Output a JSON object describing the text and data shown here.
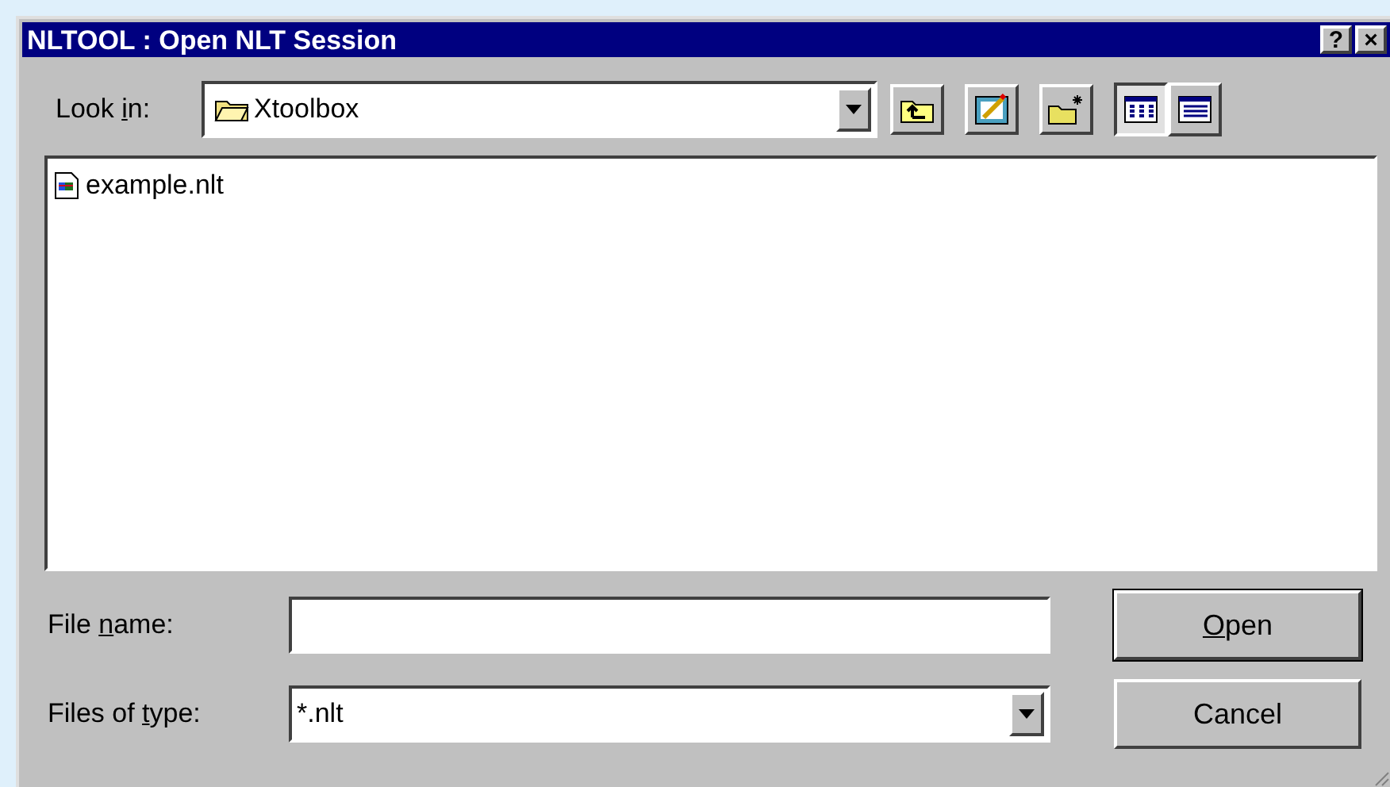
{
  "window": {
    "title": "NLTOOL : Open NLT Session",
    "title_buttons": [
      "?",
      "×"
    ]
  },
  "look_in": {
    "label": {
      "before": "Look ",
      "key": "i",
      "after": "n:"
    },
    "value": "Xtoolbox"
  },
  "toolbar": [
    {
      "kind": "up-folder"
    },
    {
      "kind": "desktop"
    },
    {
      "kind": "new-folder"
    }
  ],
  "views": [
    {
      "kind": "list",
      "selected": true
    },
    {
      "kind": "details",
      "selected": false
    }
  ],
  "files": [
    {
      "name": "example.nlt",
      "selected": false
    }
  ],
  "file_name": {
    "label": {
      "before": "File ",
      "key": "n",
      "after": "ame:"
    }
  },
  "file_type": {
    "label": {
      "before": "Files of ",
      "key": "t",
      "after": "ype:"
    },
    "value": "*.nlt"
  },
  "buttons": [
    {
      "label": {
        "key": "O",
        "after": "pen"
      },
      "default": true
    },
    {
      "label": {
        "before": "Cancel"
      },
      "default": false
    }
  ]
}
